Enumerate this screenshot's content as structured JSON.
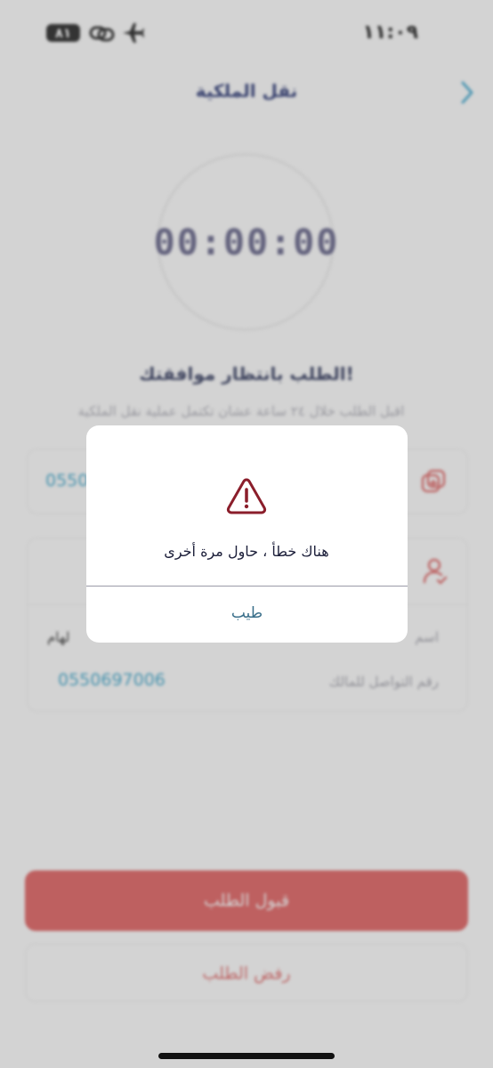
{
  "status_bar": {
    "time": "١١:٠٩",
    "battery": "٨١"
  },
  "header": {
    "title": "نقل الملكية"
  },
  "timer": {
    "value": "00:00:00"
  },
  "waiting": {
    "title": "الطلب بانتظار موافقتك!",
    "subtitle": "اقبل الطلب خلال ٢٤ ساعة عشان تكتمل عملية نقل الملكية"
  },
  "card1": {
    "phone": "0550"
  },
  "owner_card": {
    "name_label": "اسم",
    "name_value": "لهام",
    "phone_label": "رقم التواصل للمالك",
    "phone_value": "0550697006"
  },
  "buttons": {
    "accept": "قبول الطلب",
    "reject": "رفض الطلب"
  },
  "dialog": {
    "message": "هناك خطأ ، حاول مرة أخرى",
    "ok": "طيب"
  },
  "colors": {
    "accent_red": "#e05454",
    "link_blue": "#2fa0c9",
    "alert_red": "#8b1e2b"
  }
}
